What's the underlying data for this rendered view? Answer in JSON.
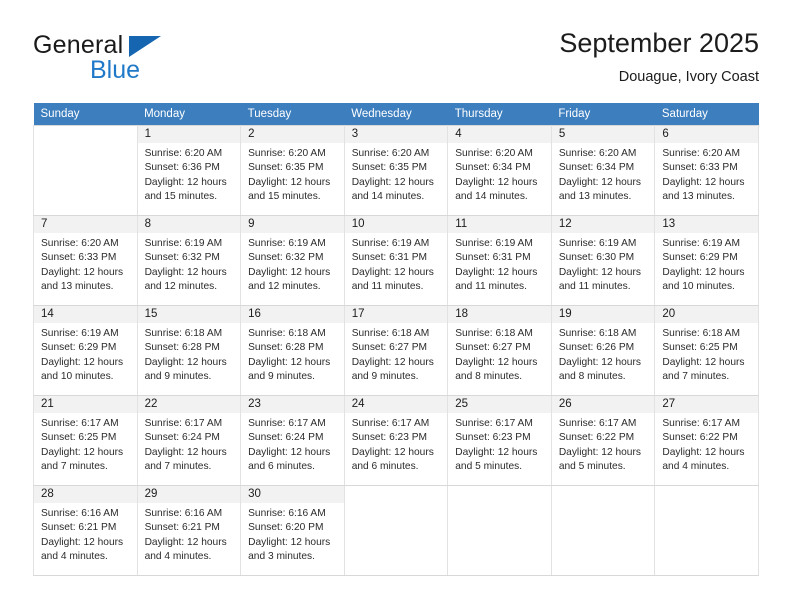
{
  "brand": {
    "name_part1": "General",
    "name_part2": "Blue",
    "accent_color": "#2079c8",
    "triangle_color": "#1565b0"
  },
  "header": {
    "title": "September 2025",
    "subtitle": "Douague, Ivory Coast"
  },
  "calendar": {
    "header_bg": "#3c7ebe",
    "daynum_bg": "#f2f2f2",
    "weekdays": [
      "Sunday",
      "Monday",
      "Tuesday",
      "Wednesday",
      "Thursday",
      "Friday",
      "Saturday"
    ],
    "labels": {
      "sunrise": "Sunrise:",
      "sunset": "Sunset:",
      "daylight": "Daylight:"
    },
    "weeks": [
      [
        {
          "day": "",
          "sunrise": "",
          "sunset": "",
          "daylight_line1": "",
          "daylight_line2": ""
        },
        {
          "day": "1",
          "sunrise": "Sunrise: 6:20 AM",
          "sunset": "Sunset: 6:36 PM",
          "daylight_line1": "Daylight: 12 hours",
          "daylight_line2": "and 15 minutes."
        },
        {
          "day": "2",
          "sunrise": "Sunrise: 6:20 AM",
          "sunset": "Sunset: 6:35 PM",
          "daylight_line1": "Daylight: 12 hours",
          "daylight_line2": "and 15 minutes."
        },
        {
          "day": "3",
          "sunrise": "Sunrise: 6:20 AM",
          "sunset": "Sunset: 6:35 PM",
          "daylight_line1": "Daylight: 12 hours",
          "daylight_line2": "and 14 minutes."
        },
        {
          "day": "4",
          "sunrise": "Sunrise: 6:20 AM",
          "sunset": "Sunset: 6:34 PM",
          "daylight_line1": "Daylight: 12 hours",
          "daylight_line2": "and 14 minutes."
        },
        {
          "day": "5",
          "sunrise": "Sunrise: 6:20 AM",
          "sunset": "Sunset: 6:34 PM",
          "daylight_line1": "Daylight: 12 hours",
          "daylight_line2": "and 13 minutes."
        },
        {
          "day": "6",
          "sunrise": "Sunrise: 6:20 AM",
          "sunset": "Sunset: 6:33 PM",
          "daylight_line1": "Daylight: 12 hours",
          "daylight_line2": "and 13 minutes."
        }
      ],
      [
        {
          "day": "7",
          "sunrise": "Sunrise: 6:20 AM",
          "sunset": "Sunset: 6:33 PM",
          "daylight_line1": "Daylight: 12 hours",
          "daylight_line2": "and 13 minutes."
        },
        {
          "day": "8",
          "sunrise": "Sunrise: 6:19 AM",
          "sunset": "Sunset: 6:32 PM",
          "daylight_line1": "Daylight: 12 hours",
          "daylight_line2": "and 12 minutes."
        },
        {
          "day": "9",
          "sunrise": "Sunrise: 6:19 AM",
          "sunset": "Sunset: 6:32 PM",
          "daylight_line1": "Daylight: 12 hours",
          "daylight_line2": "and 12 minutes."
        },
        {
          "day": "10",
          "sunrise": "Sunrise: 6:19 AM",
          "sunset": "Sunset: 6:31 PM",
          "daylight_line1": "Daylight: 12 hours",
          "daylight_line2": "and 11 minutes."
        },
        {
          "day": "11",
          "sunrise": "Sunrise: 6:19 AM",
          "sunset": "Sunset: 6:31 PM",
          "daylight_line1": "Daylight: 12 hours",
          "daylight_line2": "and 11 minutes."
        },
        {
          "day": "12",
          "sunrise": "Sunrise: 6:19 AM",
          "sunset": "Sunset: 6:30 PM",
          "daylight_line1": "Daylight: 12 hours",
          "daylight_line2": "and 11 minutes."
        },
        {
          "day": "13",
          "sunrise": "Sunrise: 6:19 AM",
          "sunset": "Sunset: 6:29 PM",
          "daylight_line1": "Daylight: 12 hours",
          "daylight_line2": "and 10 minutes."
        }
      ],
      [
        {
          "day": "14",
          "sunrise": "Sunrise: 6:19 AM",
          "sunset": "Sunset: 6:29 PM",
          "daylight_line1": "Daylight: 12 hours",
          "daylight_line2": "and 10 minutes."
        },
        {
          "day": "15",
          "sunrise": "Sunrise: 6:18 AM",
          "sunset": "Sunset: 6:28 PM",
          "daylight_line1": "Daylight: 12 hours",
          "daylight_line2": "and 9 minutes."
        },
        {
          "day": "16",
          "sunrise": "Sunrise: 6:18 AM",
          "sunset": "Sunset: 6:28 PM",
          "daylight_line1": "Daylight: 12 hours",
          "daylight_line2": "and 9 minutes."
        },
        {
          "day": "17",
          "sunrise": "Sunrise: 6:18 AM",
          "sunset": "Sunset: 6:27 PM",
          "daylight_line1": "Daylight: 12 hours",
          "daylight_line2": "and 9 minutes."
        },
        {
          "day": "18",
          "sunrise": "Sunrise: 6:18 AM",
          "sunset": "Sunset: 6:27 PM",
          "daylight_line1": "Daylight: 12 hours",
          "daylight_line2": "and 8 minutes."
        },
        {
          "day": "19",
          "sunrise": "Sunrise: 6:18 AM",
          "sunset": "Sunset: 6:26 PM",
          "daylight_line1": "Daylight: 12 hours",
          "daylight_line2": "and 8 minutes."
        },
        {
          "day": "20",
          "sunrise": "Sunrise: 6:18 AM",
          "sunset": "Sunset: 6:25 PM",
          "daylight_line1": "Daylight: 12 hours",
          "daylight_line2": "and 7 minutes."
        }
      ],
      [
        {
          "day": "21",
          "sunrise": "Sunrise: 6:17 AM",
          "sunset": "Sunset: 6:25 PM",
          "daylight_line1": "Daylight: 12 hours",
          "daylight_line2": "and 7 minutes."
        },
        {
          "day": "22",
          "sunrise": "Sunrise: 6:17 AM",
          "sunset": "Sunset: 6:24 PM",
          "daylight_line1": "Daylight: 12 hours",
          "daylight_line2": "and 7 minutes."
        },
        {
          "day": "23",
          "sunrise": "Sunrise: 6:17 AM",
          "sunset": "Sunset: 6:24 PM",
          "daylight_line1": "Daylight: 12 hours",
          "daylight_line2": "and 6 minutes."
        },
        {
          "day": "24",
          "sunrise": "Sunrise: 6:17 AM",
          "sunset": "Sunset: 6:23 PM",
          "daylight_line1": "Daylight: 12 hours",
          "daylight_line2": "and 6 minutes."
        },
        {
          "day": "25",
          "sunrise": "Sunrise: 6:17 AM",
          "sunset": "Sunset: 6:23 PM",
          "daylight_line1": "Daylight: 12 hours",
          "daylight_line2": "and 5 minutes."
        },
        {
          "day": "26",
          "sunrise": "Sunrise: 6:17 AM",
          "sunset": "Sunset: 6:22 PM",
          "daylight_line1": "Daylight: 12 hours",
          "daylight_line2": "and 5 minutes."
        },
        {
          "day": "27",
          "sunrise": "Sunrise: 6:17 AM",
          "sunset": "Sunset: 6:22 PM",
          "daylight_line1": "Daylight: 12 hours",
          "daylight_line2": "and 4 minutes."
        }
      ],
      [
        {
          "day": "28",
          "sunrise": "Sunrise: 6:16 AM",
          "sunset": "Sunset: 6:21 PM",
          "daylight_line1": "Daylight: 12 hours",
          "daylight_line2": "and 4 minutes."
        },
        {
          "day": "29",
          "sunrise": "Sunrise: 6:16 AM",
          "sunset": "Sunset: 6:21 PM",
          "daylight_line1": "Daylight: 12 hours",
          "daylight_line2": "and 4 minutes."
        },
        {
          "day": "30",
          "sunrise": "Sunrise: 6:16 AM",
          "sunset": "Sunset: 6:20 PM",
          "daylight_line1": "Daylight: 12 hours",
          "daylight_line2": "and 3 minutes."
        },
        {
          "day": "",
          "sunrise": "",
          "sunset": "",
          "daylight_line1": "",
          "daylight_line2": ""
        },
        {
          "day": "",
          "sunrise": "",
          "sunset": "",
          "daylight_line1": "",
          "daylight_line2": ""
        },
        {
          "day": "",
          "sunrise": "",
          "sunset": "",
          "daylight_line1": "",
          "daylight_line2": ""
        },
        {
          "day": "",
          "sunrise": "",
          "sunset": "",
          "daylight_line1": "",
          "daylight_line2": ""
        }
      ]
    ]
  }
}
